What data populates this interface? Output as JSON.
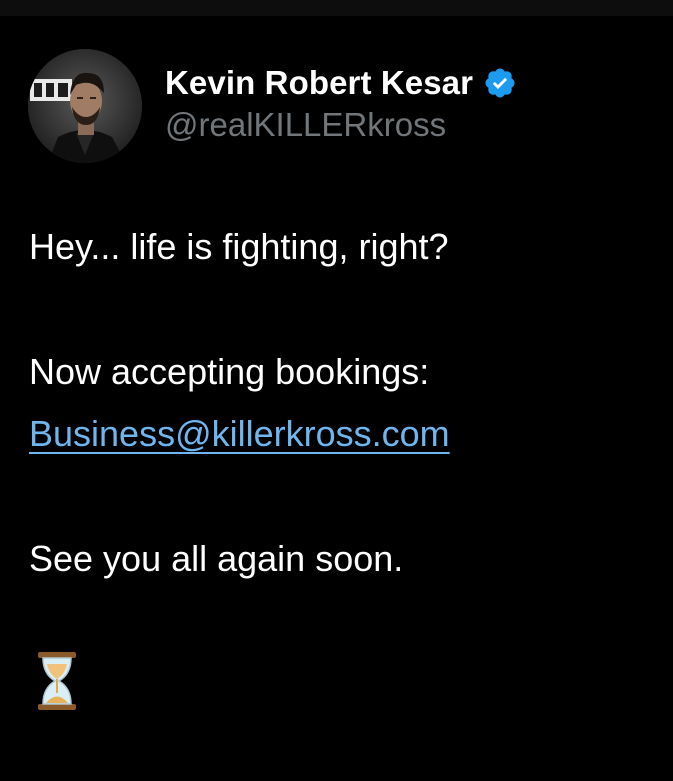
{
  "tweet": {
    "author": {
      "display_name": "Kevin Robert Kesar",
      "handle": "@realKILLERkross",
      "verified": true,
      "avatar_icon": "profile-photo",
      "verified_icon": "verified-badge-icon"
    },
    "lines": {
      "line1": "Hey... life is fighting, right?",
      "line2": "Now accepting bookings:",
      "email_link": "Business@killerkross.com",
      "line4": "See you all again soon."
    },
    "emoji": {
      "icon": "hourglass-icon",
      "glyph": "⏳"
    }
  },
  "colors": {
    "background": "#000000",
    "text_primary": "#ffffff",
    "text_secondary": "#71767b",
    "link": "#6fb6ef",
    "verified": "#1d9bf0"
  }
}
